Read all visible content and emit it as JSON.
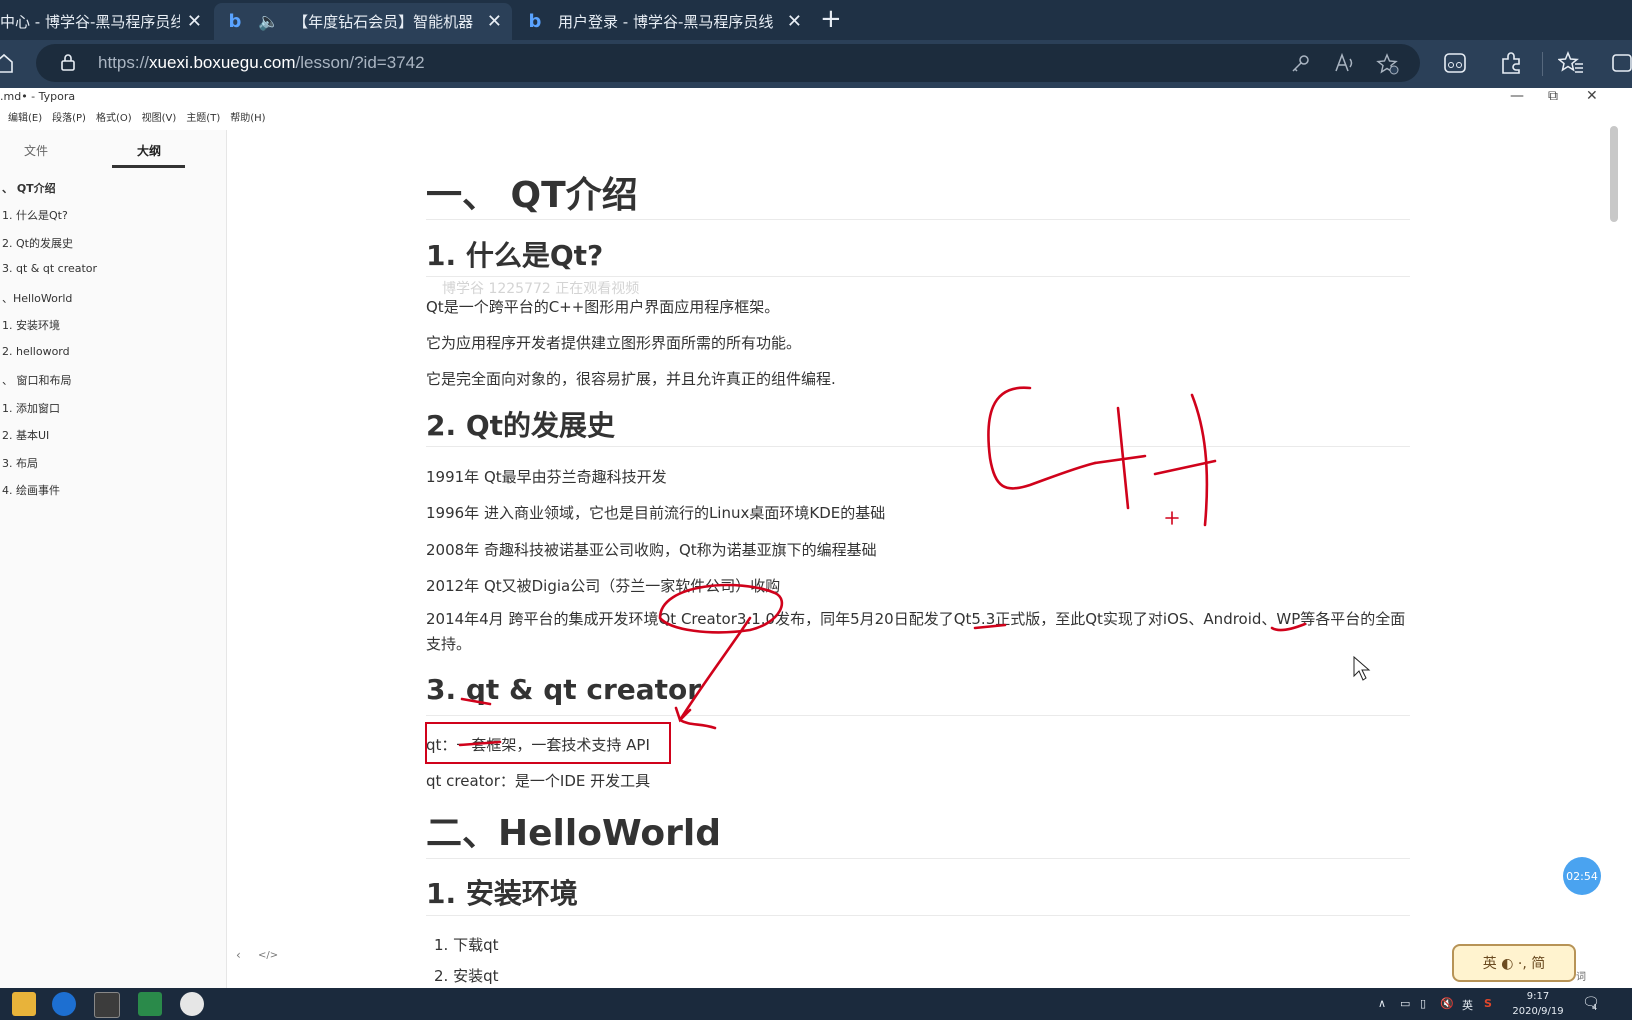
{
  "browser": {
    "tabs": [
      {
        "title": "中心 - 博学谷-黑马程序员线"
      },
      {
        "title": "【年度钻石会员】智能机器"
      },
      {
        "title": "用户登录 - 博学谷-黑马程序员线"
      }
    ],
    "new_tab_label": "+",
    "address": {
      "prefix": "https://",
      "domain": "xuexi.boxuegu.com",
      "path": "/lesson/?id=3742"
    }
  },
  "typora": {
    "title": ".md• - Typora",
    "menu": [
      "编辑(E)",
      "段落(P)",
      "格式(O)",
      "视图(V)",
      "主题(T)",
      "帮助(H)"
    ],
    "sidebar_tabs": [
      "文件",
      "大纲"
    ],
    "outline": [
      "、 QT介绍",
      "1. 什么是Qt?",
      "2. Qt的发展史",
      "3. qt & qt creator",
      "、HelloWorld",
      "1. 安装环境",
      "2. helloword",
      "、 窗口和布局",
      "1. 添加窗口",
      "2. 基本UI",
      "3. 布局",
      "4. 绘画事件"
    ],
    "footer_icons": [
      "‹",
      "</>"
    ]
  },
  "document": {
    "h1_qt": "一、 QT介绍",
    "h2_what": "1. 什么是Qt?",
    "watermark": "博学谷 1225772 正在观看视频",
    "p1": "Qt是一个跨平台的C++图形用户界面应用程序框架。",
    "p2": "它为应用程序开发者提供建立图形界面所需的所有功能。",
    "p3": "它是完全面向对象的，很容易扩展，并且允许真正的组件编程.",
    "h2_history": "2. Qt的发展史",
    "hist1": "1991年 Qt最早由芬兰奇趣科技开发",
    "hist2": "1996年 进入商业领域，它也是目前流行的Linux桌面环境KDE的基础",
    "hist3": "2008年 奇趣科技被诺基亚公司收购，Qt称为诺基亚旗下的编程基础",
    "hist4": "2012年 Qt又被Digia公司（芬兰一家软件公司）收购",
    "hist5": "2014年4月 跨平台的集成开发环境Qt Creator3.1.0发布，同年5月20日配发了Qt5.3正式版，至此Qt实现了对iOS、Android、WP等各平台的全面支持。",
    "h2_creator": "3. qt  &  qt creator",
    "def1": "qt：一套框架，一套技术支持  API",
    "def2": "qt creator：是一个IDE  开发工具",
    "h1_hello": "二、HelloWorld",
    "h2_install": "1. 安装环境",
    "list": [
      "1. 下载qt",
      "2. 安装qt"
    ]
  },
  "overlays": {
    "timer": "02:54",
    "ime_label": "英 ◐ ·, 简",
    "ime_hint": "词"
  },
  "taskbar": {
    "tray": [
      "∧",
      "英"
    ],
    "time": "9:17",
    "date": "2020/9/19",
    "notif": "4"
  },
  "colors": {
    "annotation_red": "#d0021b",
    "tab_bg": "#1f3145",
    "addr_bg": "#2b4058",
    "taskbar_bg": "#1b2a3d"
  }
}
